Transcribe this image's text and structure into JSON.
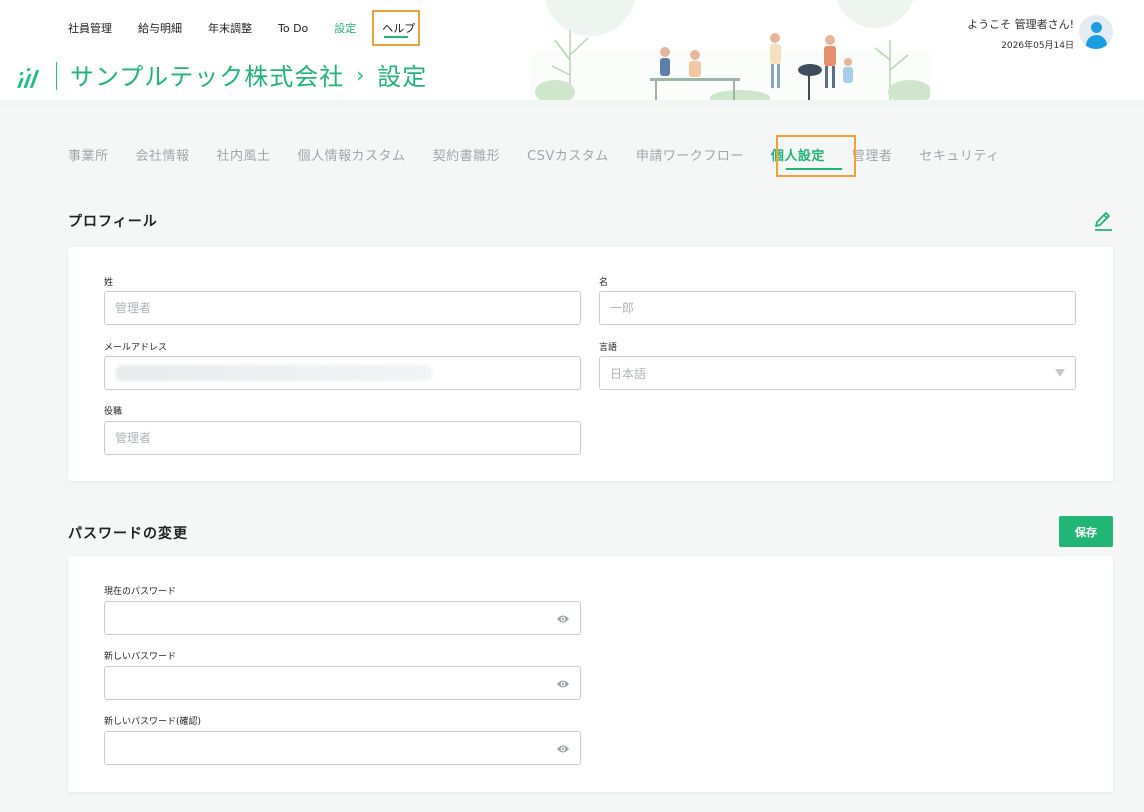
{
  "nav": {
    "items": [
      {
        "label": "社員管理"
      },
      {
        "label": "給与明細"
      },
      {
        "label": "年末調整"
      },
      {
        "label": "To Do"
      },
      {
        "label": "設定",
        "active": true
      },
      {
        "label": "ヘルプ"
      }
    ]
  },
  "brand": {
    "company": "サンプルテック株式会社",
    "separator": "›",
    "page": "設定"
  },
  "user": {
    "welcome": "ようこそ 管理者さん!",
    "date": "2026年05月14日"
  },
  "tabs": [
    {
      "label": "事業所"
    },
    {
      "label": "会社情報"
    },
    {
      "label": "社内風土"
    },
    {
      "label": "個人情報カスタム"
    },
    {
      "label": "契約書雛形"
    },
    {
      "label": "CSVカスタム"
    },
    {
      "label": "申請ワークフロー"
    },
    {
      "label": "個人設定",
      "active": true
    },
    {
      "label": "管理者"
    },
    {
      "label": "セキュリティ"
    }
  ],
  "profile": {
    "title": "プロフィール",
    "last_name_label": "姓",
    "last_name_placeholder": "管理者",
    "first_name_label": "名",
    "first_name_placeholder": "一郎",
    "email_label": "メールアドレス",
    "language_label": "言語",
    "language_value": "日本語",
    "position_label": "役職",
    "position_placeholder": "管理者"
  },
  "password": {
    "title": "パスワードの変更",
    "save_label": "保存",
    "current_label": "現在のパスワード",
    "new_label": "新しいパスワード",
    "confirm_label": "新しいパスワード(確認)"
  },
  "colors": {
    "accent": "#21b576",
    "highlight": "#f0a13a",
    "avatar": "#1d9de0"
  }
}
